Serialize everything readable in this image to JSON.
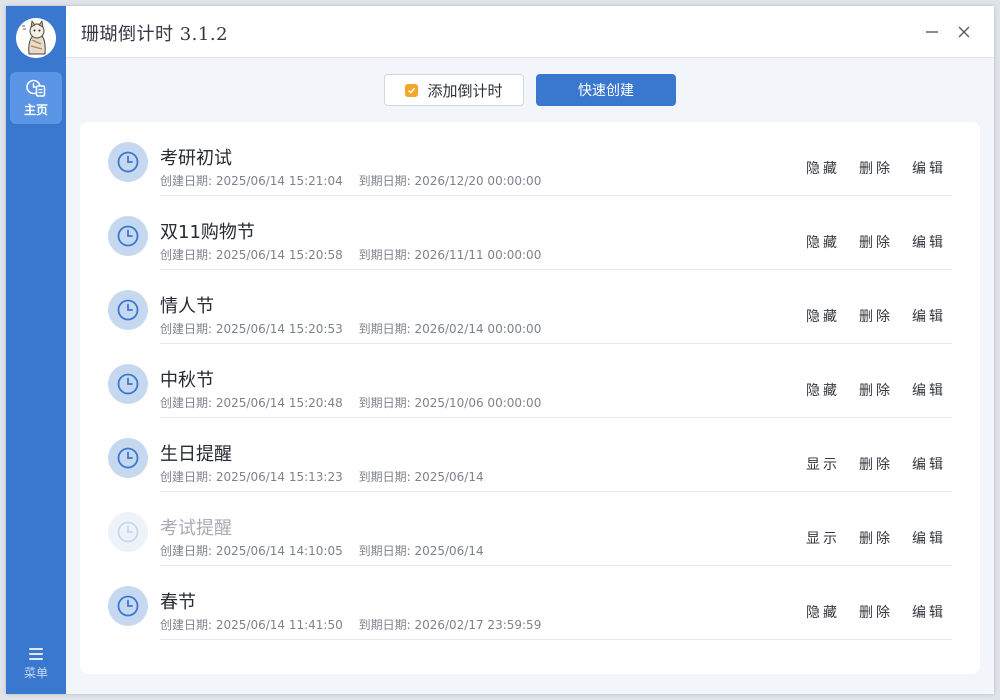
{
  "app": {
    "title": "珊瑚倒计时 3.1.2"
  },
  "sidebar": {
    "home_label": "主页",
    "menu_label": "菜单"
  },
  "toolbar": {
    "add_label": "添加倒计时",
    "quick_label": "快速创建"
  },
  "labels": {
    "created": "创建日期:",
    "due": "到期日期:",
    "hide": "隐藏",
    "show": "显示",
    "delete": "删除",
    "edit": "编辑"
  },
  "items": [
    {
      "name": "考研初试",
      "created": "2025/06/14 15:21:04",
      "due": "2026/12/20 00:00:00",
      "vis": "隐藏",
      "dimmed": false
    },
    {
      "name": "双11购物节",
      "created": "2025/06/14 15:20:58",
      "due": "2026/11/11 00:00:00",
      "vis": "隐藏",
      "dimmed": false
    },
    {
      "name": "情人节",
      "created": "2025/06/14 15:20:53",
      "due": "2026/02/14 00:00:00",
      "vis": "隐藏",
      "dimmed": false
    },
    {
      "name": "中秋节",
      "created": "2025/06/14 15:20:48",
      "due": "2025/10/06 00:00:00",
      "vis": "隐藏",
      "dimmed": false
    },
    {
      "name": "生日提醒",
      "created": "2025/06/14 15:13:23",
      "due": "2025/06/14",
      "vis": "显示",
      "dimmed": false
    },
    {
      "name": "考试提醒",
      "created": "2025/06/14 14:10:05",
      "due": "2025/06/14",
      "vis": "显示",
      "dimmed": true
    },
    {
      "name": "春节",
      "created": "2025/06/14 11:41:50",
      "due": "2026/02/17 23:59:59",
      "vis": "隐藏",
      "dimmed": false
    }
  ],
  "colors": {
    "accent": "#3a78cf",
    "clock_bg": "#c6d8f0",
    "clock_stroke": "#3a78cf",
    "clock_dim_stroke": "#c9d7ec"
  },
  "icons": {
    "home": "home-timer-icon",
    "menu": "hamburger-icon",
    "clock": "clock-icon",
    "add": "checkbox-icon",
    "minimize": "minimize-icon",
    "close": "close-icon"
  }
}
